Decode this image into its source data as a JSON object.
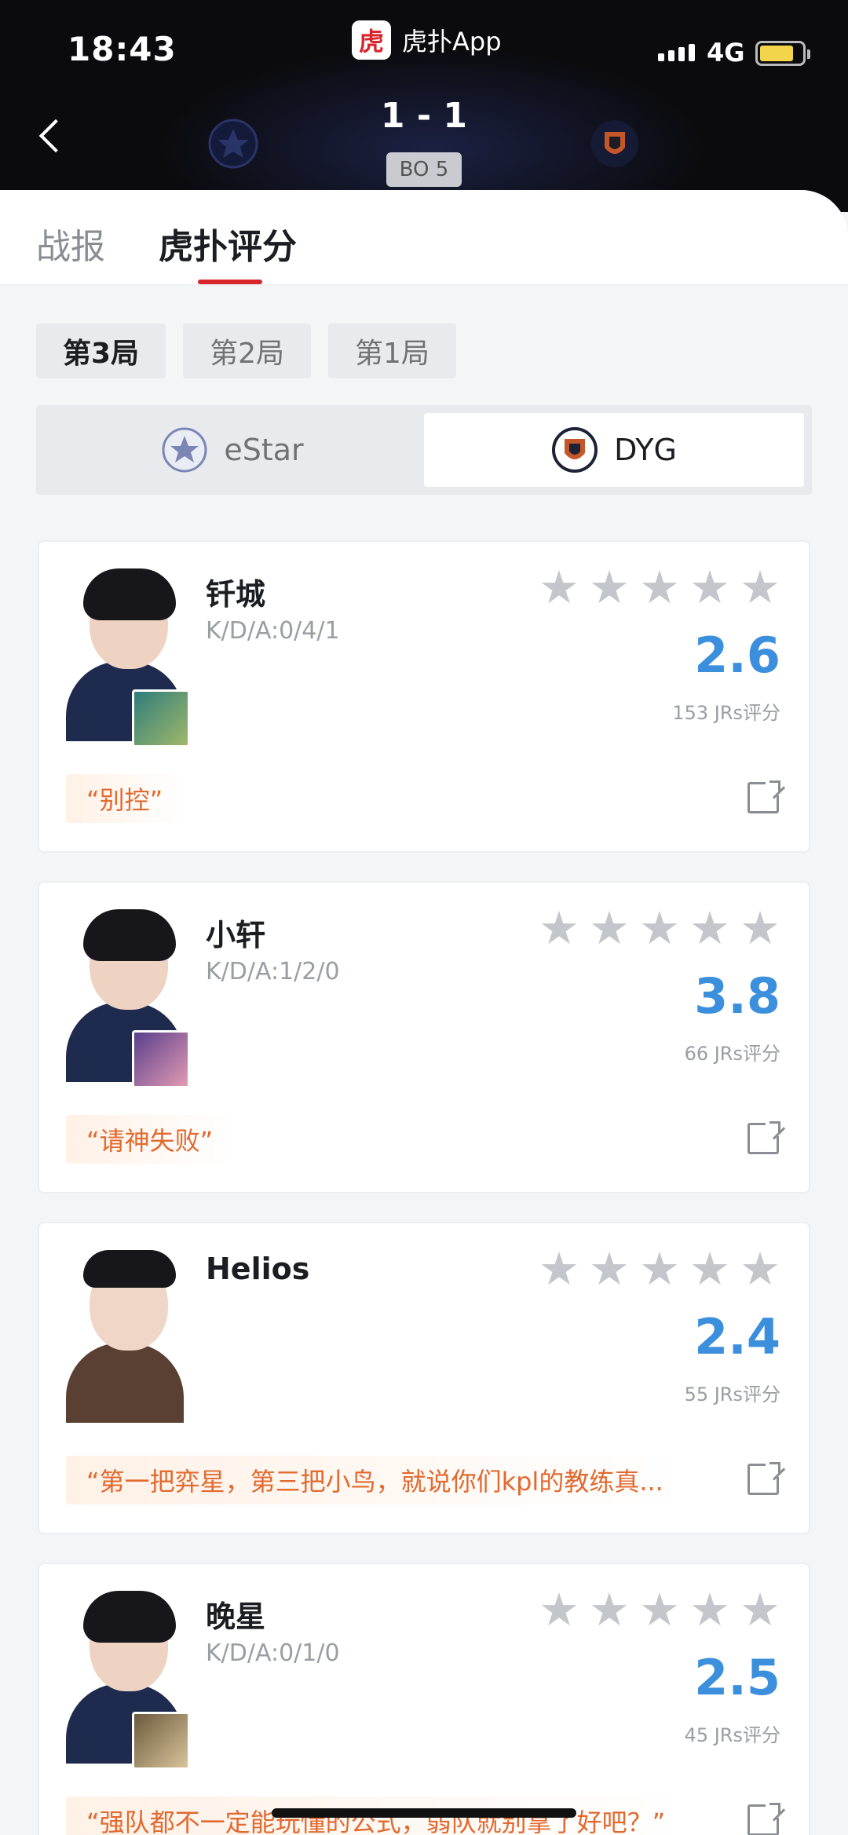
{
  "status": {
    "time": "18:43",
    "app": "虎扑App",
    "network": "4G"
  },
  "match": {
    "score": "1 - 1",
    "format": "BO 5"
  },
  "tabs": [
    {
      "label": "战报"
    },
    {
      "label": "虎扑评分"
    }
  ],
  "game_tabs": [
    {
      "label": "第3局"
    },
    {
      "label": "第2局"
    },
    {
      "label": "第1局"
    }
  ],
  "teams": [
    {
      "name": "eStar"
    },
    {
      "name": "DYG"
    }
  ],
  "players": [
    {
      "name": "钎城",
      "kda": "K/D/A:0/4/1",
      "rating": "2.6",
      "votes": "153 JRs评分",
      "quote": "“别控”"
    },
    {
      "name": "小轩",
      "kda": "K/D/A:1/2/0",
      "rating": "3.8",
      "votes": "66 JRs评分",
      "quote": "“请神失败”"
    },
    {
      "name": "Helios",
      "kda": "",
      "rating": "2.4",
      "votes": "55 JRs评分",
      "quote": "“第一把弈星，第三把小鸟，就说你们kpl的教练真..."
    },
    {
      "name": "晚星",
      "kda": "K/D/A:0/1/0",
      "rating": "2.5",
      "votes": "45 JRs评分",
      "quote": "“强队都不一定能玩懂的公式，弱队就别拿了好吧？”"
    }
  ],
  "colors": {
    "accent": "#d8242b",
    "rating": "#3b8fdc",
    "quote": "#e2692f"
  }
}
